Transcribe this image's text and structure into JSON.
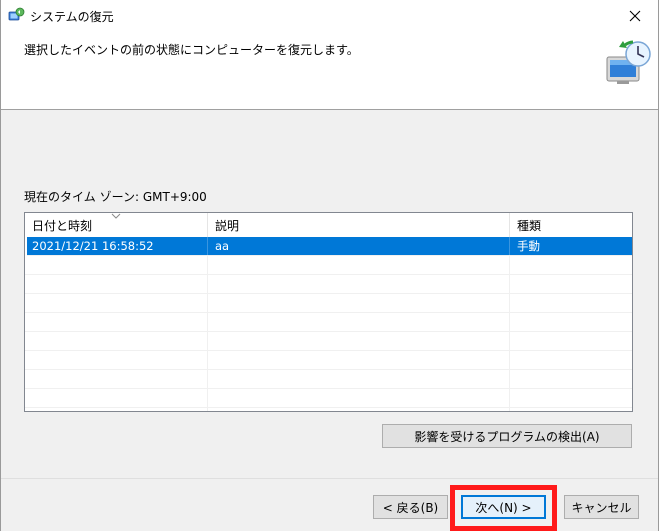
{
  "window": {
    "title": "システムの復元"
  },
  "header": {
    "instruction": "選択したイベントの前の状態にコンピューターを復元します。"
  },
  "timezone_label": "現在のタイム ゾーン: GMT+9:00",
  "table": {
    "columns": [
      "日付と時刻",
      "説明",
      "種類"
    ],
    "rows": [
      {
        "date": "2021/12/21 16:58:52",
        "description": "aa",
        "type": "手動",
        "selected": true
      }
    ]
  },
  "buttons": {
    "detect": "影響を受けるプログラムの検出(A)",
    "back": "< 戻る(B)",
    "next": "次へ(N) >",
    "cancel": "キャンセル"
  },
  "colors": {
    "selection": "#0078d7",
    "highlight": "#ff1a1a"
  }
}
